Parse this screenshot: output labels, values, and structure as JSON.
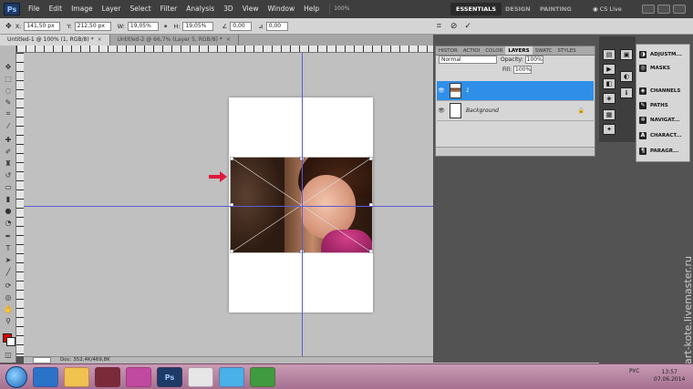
{
  "menu": {
    "app_logo": "Ps",
    "items": [
      "File",
      "Edit",
      "Image",
      "Layer",
      "Select",
      "Filter",
      "Analysis",
      "3D",
      "View",
      "Window",
      "Help"
    ],
    "zoom": "100%",
    "workspaces": [
      "ESSENTIALS",
      "DESIGN",
      "PAINTING"
    ],
    "cs_live": "CS Live"
  },
  "options": {
    "x_label": "X:",
    "x_value": "141,50 px",
    "y_label": "Y:",
    "y_value": "212,50 px",
    "w_label": "W:",
    "w_value": "19,05%",
    "h_label": "H:",
    "h_value": "19,05%",
    "angle_value": "0,00",
    "hskew_value": "0,00"
  },
  "tabs": [
    {
      "label": "Untitled-1 @ 100% (1, RGB/8) *",
      "active": true
    },
    {
      "label": "Untitled-2 @ 66,7% (Layer 5, RGB/8) *",
      "active": false
    }
  ],
  "layers_panel": {
    "tabs": [
      "HISTOR",
      "ACTIOI",
      "COLOR",
      "LAYERS",
      "SWATC",
      "STYLES"
    ],
    "blend_mode": "Normal",
    "opacity_label": "Opacity:",
    "opacity_value": "100%",
    "fill_label": "Fill:",
    "fill_value": "100%",
    "layers": [
      {
        "name": "1",
        "selected": true
      },
      {
        "name": "Background",
        "selected": false
      }
    ]
  },
  "dock": {
    "items": [
      "ADJUSTM...",
      "MASKS",
      "CHANNELS",
      "PATHS",
      "NAVIGAT...",
      "CHARACT...",
      "PARAGR..."
    ]
  },
  "status": {
    "zoom": "",
    "doc": "Doc: 352,4K/469,8K"
  },
  "watermark": "art-kote.livemaster.ru",
  "taskbar": {
    "apps": [
      "",
      "",
      "",
      "",
      "Ps",
      "",
      "",
      "",
      ""
    ],
    "lang": "РУС",
    "time": "13:57",
    "date": "07.06.2014"
  },
  "colors": {
    "foreground": "#e00000",
    "selection": "#2f8fe8",
    "guide": "#5b5bd8",
    "arrow": "#e01a3c"
  }
}
